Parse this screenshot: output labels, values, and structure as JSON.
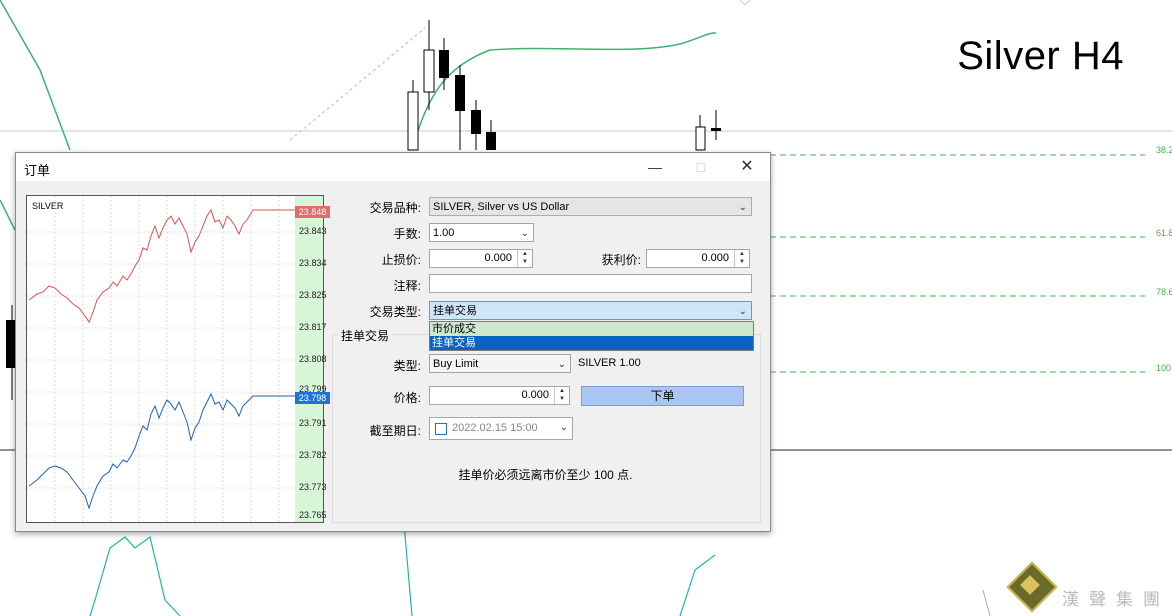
{
  "chart": {
    "title": "Silver H4",
    "fib_levels": [
      "38.2",
      "61.8",
      "78.6",
      "100.0"
    ],
    "colors": {
      "ma_line": "#3cb371",
      "fib": "#3cb44b",
      "osc": "#20b2aa"
    }
  },
  "dialog": {
    "title": "订单",
    "mini_chart": {
      "symbol": "SILVER",
      "ask_tag": "23.848",
      "bid_tag": "23.798",
      "price_labels": [
        "23.843",
        "23.834",
        "23.825",
        "23.817",
        "23.808",
        "23.799",
        "23.791",
        "23.782",
        "23.773",
        "23.765"
      ],
      "colors": {
        "ask": "#e26b6b",
        "bid": "#1f72d6"
      }
    },
    "form": {
      "symbol_label": "交易品种:",
      "symbol_value": "SILVER, Silver vs US Dollar",
      "volume_label": "手数:",
      "volume_value": "1.00",
      "sl_label": "止损价:",
      "sl_value": "0.000",
      "tp_label": "获利价:",
      "tp_value": "0.000",
      "comment_label": "注释:",
      "type_label": "交易类型:",
      "type_value": "挂单交易",
      "type_options": [
        "市价成交",
        "挂单交易"
      ]
    },
    "pending": {
      "group_title": "挂单交易",
      "kind_label": "类型:",
      "kind_value": "Buy Limit",
      "symbol_info": "SILVER 1.00",
      "price_label": "价格:",
      "price_value": "0.000",
      "place_button": "下单",
      "expiry_label": "截至期日:",
      "expiry_value": "2022.02.15 15:00",
      "info_text": "挂单价必须远离市价至少 100 点."
    }
  },
  "logo": {
    "name": "漢聲集團"
  }
}
